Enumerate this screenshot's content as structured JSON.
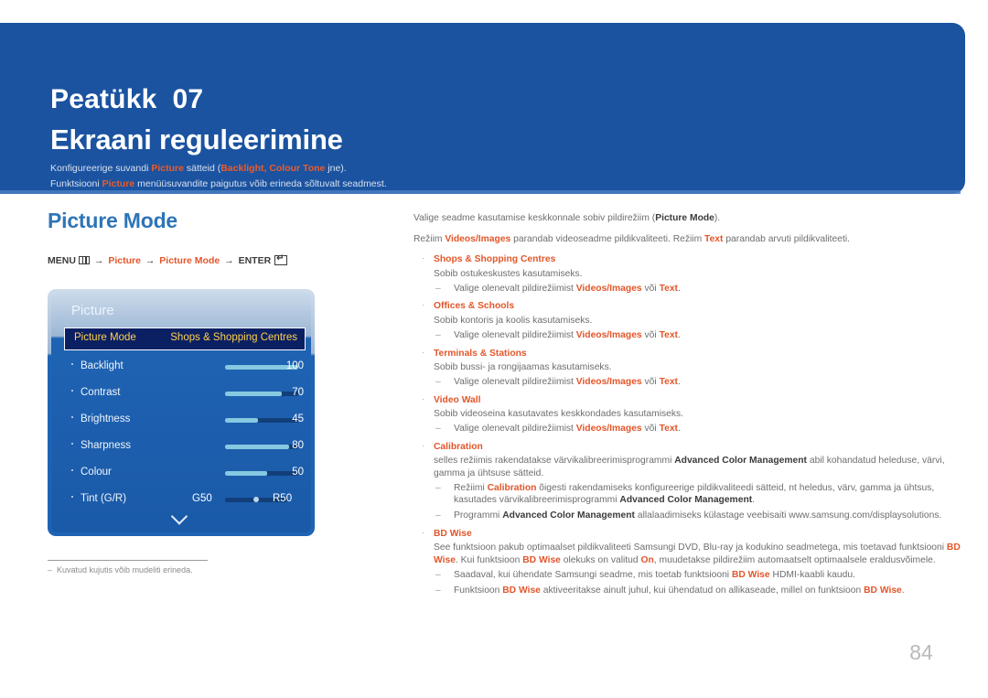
{
  "banner": {
    "chapter_word": "Peatükk",
    "chapter_number": "07",
    "title": "Ekraani reguleerimine",
    "sub1_a": "Konfigureerige suvandi ",
    "sub1_b": "Picture",
    "sub1_c": " sätteid (",
    "sub1_d": "Backlight, Colour Tone",
    "sub1_e": " jne).",
    "sub2_a": "Funktsiooni ",
    "sub2_b": "Picture",
    "sub2_c": " menüüsuvandite paigutus võib erineda sõltuvalt seadmest."
  },
  "left": {
    "section_title": "Picture Mode",
    "breadcrumb": {
      "menu": "MENU",
      "arrow": "→",
      "item1": "Picture",
      "item2": "Picture Mode",
      "enter": "ENTER"
    },
    "footnote_rule": "",
    "footnote_dash": "‒",
    "footnote_text": "Kuvatud kujutis võib mudeliti erineda."
  },
  "tv_menu": {
    "heading": "Picture",
    "selected_row": {
      "label": "Picture Mode",
      "value": "Shops & Shopping Centres"
    },
    "rows": [
      {
        "label": "Backlight",
        "value": "100",
        "fill_pct": 100
      },
      {
        "label": "Contrast",
        "value": "70",
        "fill_pct": 78
      },
      {
        "label": "Brightness",
        "value": "45",
        "fill_pct": 45
      },
      {
        "label": "Sharpness",
        "value": "80",
        "fill_pct": 88
      },
      {
        "label": "Colour",
        "value": "50",
        "fill_pct": 58
      }
    ],
    "tint_row": {
      "label": "Tint (G/R)",
      "left_value": "G50",
      "right_value": "R50"
    }
  },
  "right": {
    "intro1_a": "Valige seadme kasutamise keskkonnale sobiv pildirežiim (",
    "intro1_b": "Picture Mode",
    "intro1_c": ").",
    "intro2_a": "Režiim ",
    "intro2_b": "Videos/Images",
    "intro2_c": " parandab videoseadme pildikvaliteeti. Režiim ",
    "intro2_d": "Text",
    "intro2_e": " parandab arvuti pildikvaliteeti.",
    "bullet_mark": "·",
    "sub_mark": "‒",
    "common_sub_a": "Valige olenevalt pildirežiimist ",
    "common_sub_b": "Videos/Images",
    "common_sub_c": " või ",
    "common_sub_d": "Text",
    "common_sub_e": ".",
    "items": [
      {
        "head": "Shops & Shopping Centres",
        "body": "Sobib ostukeskustes kasutamiseks."
      },
      {
        "head": "Offices & Schools",
        "body": "Sobib kontoris ja koolis kasutamiseks."
      },
      {
        "head": "Terminals & Stations",
        "body": "Sobib bussi- ja rongijaamas kasutamiseks."
      },
      {
        "head": "Video Wall",
        "body": "Sobib videoseina kasutavates keskkondades kasutamiseks."
      }
    ],
    "calibration": {
      "head": "Calibration",
      "body_a": "selles režiimis rakendatakse värvikalibreerimisprogrammi ",
      "body_b": "Advanced Color Management",
      "body_c": " abil kohandatud heleduse, värvi, gamma ja ühtsuse sätteid.",
      "sub1_a": "Režiimi ",
      "sub1_b": "Calibration",
      "sub1_c": " õigesti rakendamiseks konfigureerige pildikvaliteedi sätteid, nt heledus, värv, gamma ja ühtsus, kasutades värvikalibreerimisprogrammi ",
      "sub1_d": "Advanced Color Management",
      "sub1_e": ".",
      "sub2_a": "Programmi ",
      "sub2_b": "Advanced Color Management",
      "sub2_c": " allalaadimiseks külastage veebisaiti www.samsung.com/displaysolutions."
    },
    "bdwise": {
      "head": "BD Wise",
      "body_a": "See funktsioon pakub optimaalset pildikvaliteeti Samsungi DVD, Blu-ray ja kodukino seadmetega, mis toetavad funktsiooni ",
      "body_b": "BD Wise",
      "body_c": ". Kui funktsioon ",
      "body_d": "BD Wise",
      "body_e": " olekuks on valitud ",
      "body_f": "On",
      "body_g": ", muudetakse pildirežiim automaatselt optimaalsele eraldusvõimele.",
      "sub1_a": "Saadaval, kui ühendate Samsungi seadme, mis toetab funktsiooni ",
      "sub1_b": "BD Wise",
      "sub1_c": " HDMI-kaabli kaudu.",
      "sub2_a": "Funktsioon ",
      "sub2_b": "BD Wise",
      "sub2_c": " aktiveeritakse ainult juhul, kui ühendatud on allikaseade, millel on funktsioon ",
      "sub2_d": "BD Wise",
      "sub2_e": "."
    }
  },
  "page_number": "84",
  "colors": {
    "banner_blue": "#1b53a0",
    "accent_orange": "#e2562a",
    "section_blue": "#2e75b6",
    "menu_blue": "#1e63b4",
    "menu_selected": "#0b1f63",
    "menu_yellow": "#ffd24a",
    "slider_fill": "#86c9e0",
    "body_gray": "#6d6e71"
  }
}
